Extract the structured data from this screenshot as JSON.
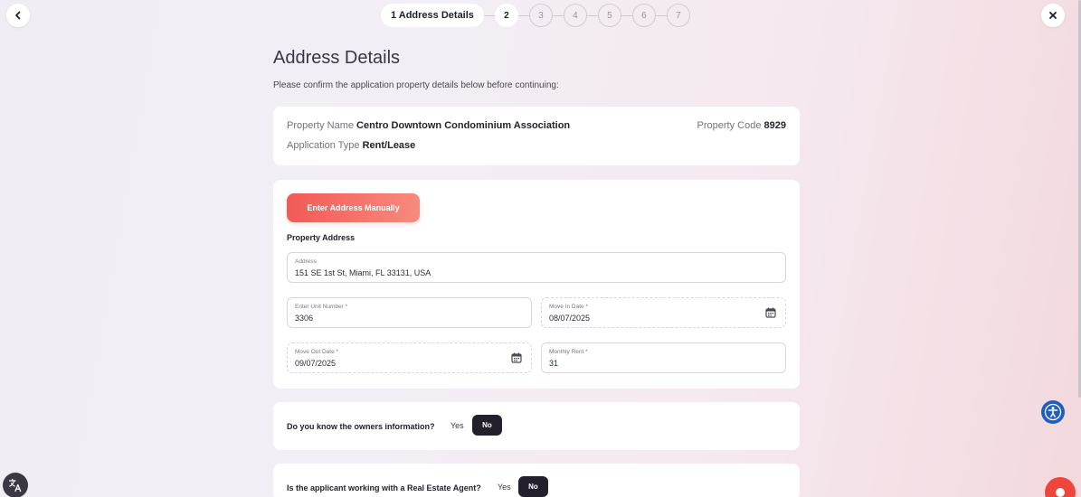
{
  "nav": {
    "back_icon": "chevron-left-icon",
    "close_icon": "close-icon"
  },
  "stepper": {
    "active_label": "1 Address Details",
    "steps": [
      "2",
      "3",
      "4",
      "5",
      "6",
      "7"
    ]
  },
  "page": {
    "title": "Address Details",
    "subtitle": "Please confirm the application property details below before continuing:"
  },
  "property": {
    "name_label": "Property Name",
    "name_value": "Centro Downtown Condominium Association",
    "code_label": "Property Code",
    "code_value": "8929",
    "type_label": "Application Type",
    "type_value": "Rent/Lease"
  },
  "address_form": {
    "manual_button": "Enter Address Manually",
    "section_label": "Property Address",
    "address_label": "Address",
    "address_value": "151 SE 1st St, Miami, FL 33131, USA",
    "unit_label": "Enter Unit Number *",
    "unit_value": "3306",
    "move_in_label": "Move In Date *",
    "move_in_value": "08/07/2025",
    "move_out_label": "Move Out Date *",
    "move_out_value": "09/07/2025",
    "rent_label": "Monthly Rent *",
    "rent_value": "31"
  },
  "owners_question": {
    "text": "Do you know the owners information?",
    "yes": "Yes",
    "no": "No"
  },
  "agent_question": {
    "text": "Is the applicant working with a Real Estate Agent?",
    "yes": "Yes",
    "no": "No"
  },
  "colors": {
    "accent": "#f25a55",
    "dark_button": "#23202c",
    "a11y": "#1f5fbf"
  },
  "icons": {
    "calendar": "calendar-icon",
    "accessibility": "accessibility-icon",
    "translate": "translate-icon",
    "chat": "chat-icon"
  }
}
